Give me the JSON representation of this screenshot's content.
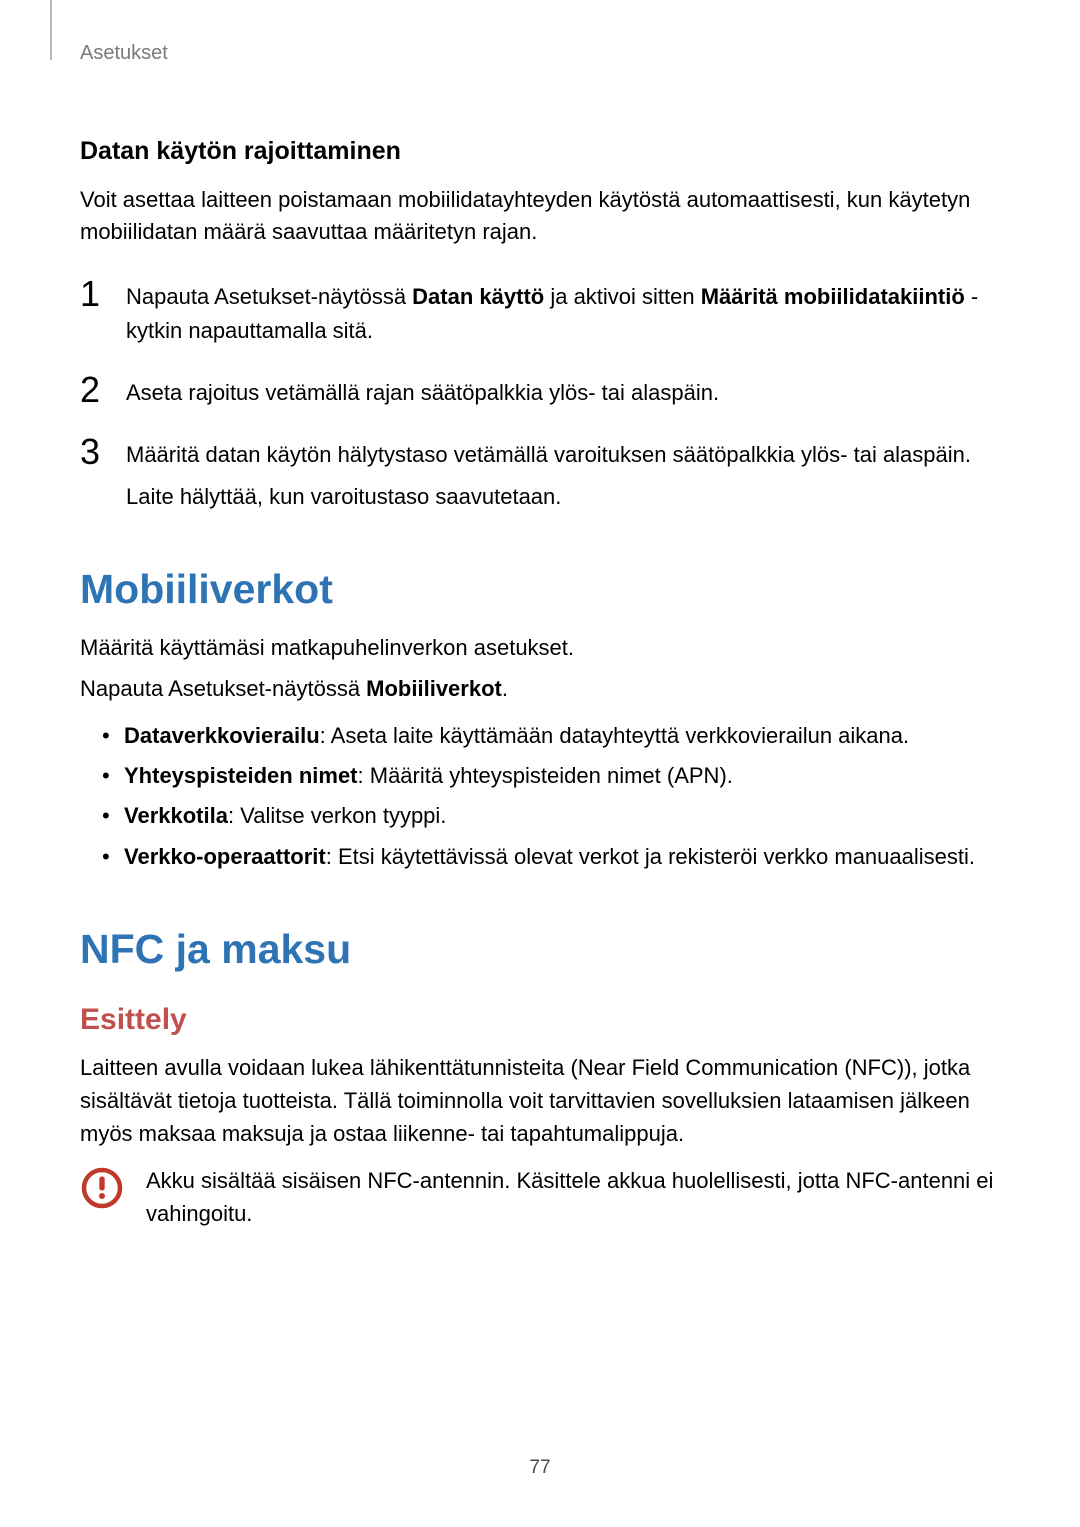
{
  "header": {
    "crumb": "Asetukset"
  },
  "section_datalimit": {
    "title": "Datan käytön rajoittaminen",
    "intro": "Voit asettaa laitteen poistamaan mobiilidatayhteyden käytöstä automaattisesti, kun käytetyn mobiilidatan määrä saavuttaa määritetyn rajan.",
    "steps": [
      {
        "num": "1",
        "pre": "Napauta Asetukset-näytössä ",
        "bold1": "Datan käyttö",
        "mid": " ja aktivoi sitten ",
        "bold2": "Määritä mobiilidatakiintiö",
        "post": " -kytkin napauttamalla sitä."
      },
      {
        "num": "2",
        "text": "Aseta rajoitus vetämällä rajan säätöpalkkia ylös- tai alaspäin."
      },
      {
        "num": "3",
        "line1": "Määritä datan käytön hälytystaso vetämällä varoituksen säätöpalkkia ylös- tai alaspäin.",
        "line2": "Laite hälyttää, kun varoitustaso saavutetaan."
      }
    ]
  },
  "section_mobile": {
    "title": "Mobiiliverkot",
    "intro1": "Määritä käyttämäsi matkapuhelinverkon asetukset.",
    "intro2_pre": "Napauta Asetukset-näytössä ",
    "intro2_bold": "Mobiiliverkot",
    "intro2_post": ".",
    "bullets": [
      {
        "bold": "Dataverkkovierailu",
        "rest": ": Aseta laite käyttämään datayhteyttä verkkovierailun aikana."
      },
      {
        "bold": "Yhteyspisteiden nimet",
        "rest": ": Määritä yhteyspisteiden nimet (APN)."
      },
      {
        "bold": "Verkkotila",
        "rest": ": Valitse verkon tyyppi."
      },
      {
        "bold": "Verkko-operaattorit",
        "rest": ": Etsi käytettävissä olevat verkot ja rekisteröi verkko manuaalisesti."
      }
    ]
  },
  "section_nfc": {
    "title": "NFC ja maksu",
    "subtitle": "Esittely",
    "intro": "Laitteen avulla voidaan lukea lähikenttätunnisteita (Near Field Communication (NFC)), jotka sisältävät tietoja tuotteista. Tällä toiminnolla voit tarvittavien sovelluksien lataamisen jälkeen myös maksaa maksuja ja ostaa liikenne- tai tapahtumalippuja.",
    "warning": "Akku sisältää sisäisen NFC-antennin. Käsittele akkua huolellisesti, jotta NFC-antenni ei vahingoitu."
  },
  "page_number": "77"
}
